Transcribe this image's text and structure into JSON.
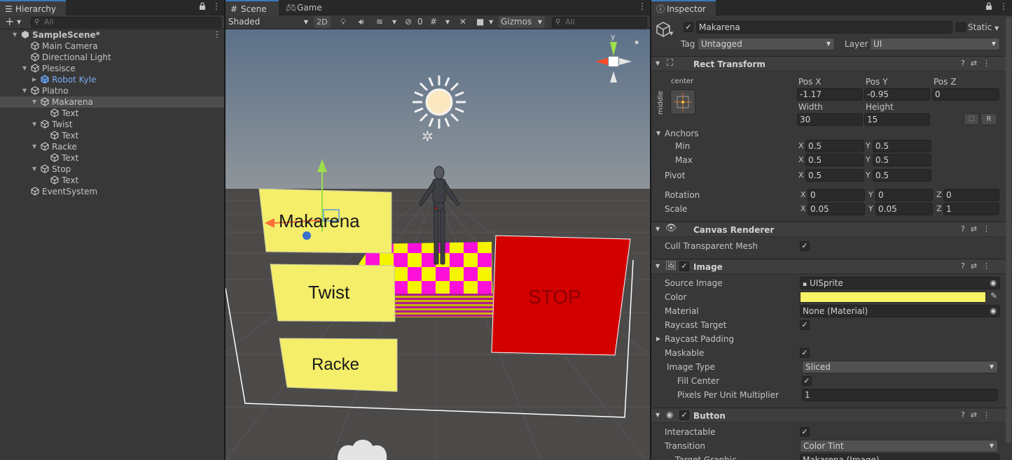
{
  "hierarchy": {
    "tab_label": "Hierarchy",
    "search_placeholder": "All",
    "rows": [
      {
        "label": "SampleScene*",
        "depth": 0,
        "expand": "open",
        "type": "scene",
        "selected": false,
        "blue": false
      },
      {
        "label": "Main Camera",
        "depth": 1,
        "expand": "none",
        "type": "object",
        "selected": false,
        "blue": false
      },
      {
        "label": "Directional Light",
        "depth": 1,
        "expand": "none",
        "type": "object",
        "selected": false,
        "blue": false
      },
      {
        "label": "Plesisce",
        "depth": 1,
        "expand": "open",
        "type": "object",
        "selected": false,
        "blue": false
      },
      {
        "label": "Robot Kyle",
        "depth": 2,
        "expand": "closed",
        "type": "prefab",
        "selected": false,
        "blue": true
      },
      {
        "label": "Platno",
        "depth": 1,
        "expand": "open",
        "type": "object",
        "selected": false,
        "blue": false
      },
      {
        "label": "Makarena",
        "depth": 2,
        "expand": "open",
        "type": "object",
        "selected": true,
        "blue": false
      },
      {
        "label": "Text",
        "depth": 3,
        "expand": "none",
        "type": "object",
        "selected": false,
        "blue": false
      },
      {
        "label": "Twist",
        "depth": 2,
        "expand": "open",
        "type": "object",
        "selected": false,
        "blue": false
      },
      {
        "label": "Text",
        "depth": 3,
        "expand": "none",
        "type": "object",
        "selected": false,
        "blue": false
      },
      {
        "label": "Racke",
        "depth": 2,
        "expand": "open",
        "type": "object",
        "selected": false,
        "blue": false
      },
      {
        "label": "Text",
        "depth": 3,
        "expand": "none",
        "type": "object",
        "selected": false,
        "blue": false
      },
      {
        "label": "Stop",
        "depth": 2,
        "expand": "open",
        "type": "object",
        "selected": false,
        "blue": false
      },
      {
        "label": "Text",
        "depth": 3,
        "expand": "none",
        "type": "object",
        "selected": false,
        "blue": false
      },
      {
        "label": "EventSystem",
        "depth": 1,
        "expand": "none",
        "type": "object",
        "selected": false,
        "blue": false
      }
    ]
  },
  "scene": {
    "tab_scene": "Scene",
    "tab_game": "Game",
    "shading": "Shaded",
    "mode_2d": "2D",
    "hidden_count": "0",
    "gizmos": "Gizmos",
    "search_placeholder": "All",
    "axis_y": "y",
    "buttons": {
      "makarena": "Makarena",
      "twist": "Twist",
      "racke": "Racke",
      "stop": "STOP"
    },
    "colors": {
      "sky_top": "#5a6f86",
      "sky_bottom": "#8d949b",
      "ground": "#4d4b4a",
      "button_yellow": "#f4ee6a",
      "stop_red": "#d30000",
      "checker_a": "#f5f500",
      "checker_b": "#ff10d8"
    }
  },
  "inspector": {
    "tab_label": "Inspector",
    "object_name": "Makarena",
    "active": true,
    "static_label": "Static",
    "tag_label": "Tag",
    "tag_value": "Untagged",
    "layer_label": "Layer",
    "layer_value": "UI",
    "rect_transform": {
      "title": "Rect Transform",
      "anchor_h": "center",
      "anchor_v": "middle",
      "pos_x_label": "Pos X",
      "pos_x": "-1.17",
      "pos_y_label": "Pos Y",
      "pos_y": "-0.95",
      "pos_z_label": "Pos Z",
      "pos_z": "0",
      "width_label": "Width",
      "width": "30",
      "height_label": "Height",
      "height": "15",
      "r_button": "R",
      "anchors_label": "Anchors",
      "min_label": "Min",
      "min_x": "0.5",
      "min_y": "0.5",
      "max_label": "Max",
      "max_x": "0.5",
      "max_y": "0.5",
      "pivot_label": "Pivot",
      "pivot_x": "0.5",
      "pivot_y": "0.5",
      "rotation_label": "Rotation",
      "rot_x": "0",
      "rot_y": "0",
      "rot_z": "0",
      "scale_label": "Scale",
      "scale_x": "0.05",
      "scale_y": "0.05",
      "scale_z": "1",
      "x": "X",
      "y": "Y",
      "z": "Z"
    },
    "canvas_renderer": {
      "title": "Canvas Renderer",
      "cull_label": "Cull Transparent Mesh",
      "cull": true
    },
    "image": {
      "title": "Image",
      "source_label": "Source Image",
      "source_value": "UISprite",
      "color_label": "Color",
      "color_value": "#f8f266",
      "material_label": "Material",
      "material_value": "None (Material)",
      "raycast_target_label": "Raycast Target",
      "raycast_padding_label": "Raycast Padding",
      "maskable_label": "Maskable",
      "image_type_label": "Image Type",
      "image_type_value": "Sliced",
      "fill_center_label": "Fill Center",
      "ppu_label": "Pixels Per Unit Multiplier",
      "ppu_value": "1"
    },
    "button": {
      "title": "Button",
      "interactable_label": "Interactable",
      "transition_label": "Transition",
      "transition_value": "Color Tint",
      "target_graphic_label": "Target Graphic",
      "target_graphic_value": "Makarena (Image)"
    }
  }
}
